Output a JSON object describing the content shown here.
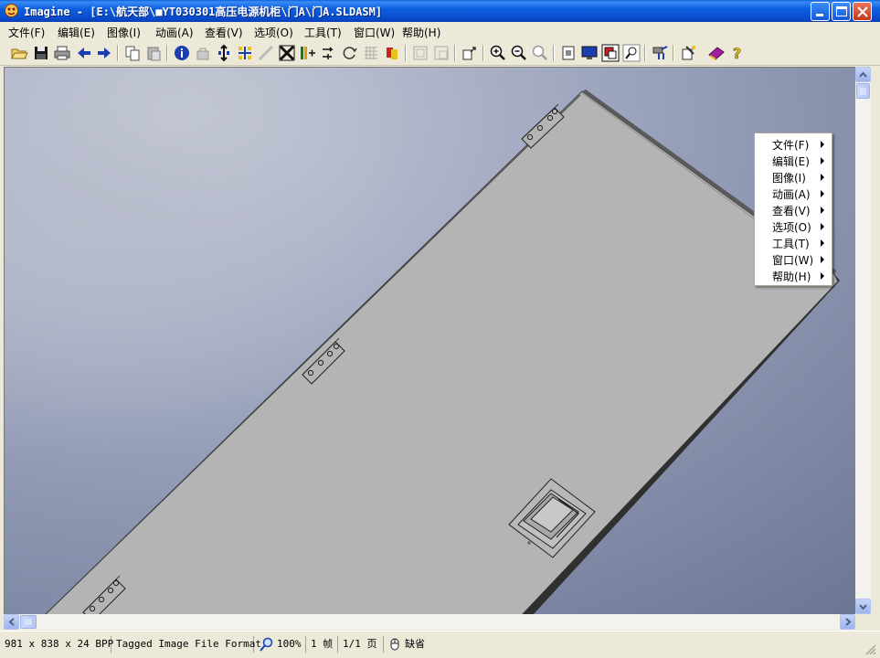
{
  "window": {
    "title": "Imagine - [E:\\航天部\\■YT030301高压电源机柜\\门A\\门A.SLDASM]"
  },
  "menubar": {
    "items": [
      {
        "label": "文件(F)"
      },
      {
        "label": "编辑(E)"
      },
      {
        "label": "图像(I)"
      },
      {
        "label": "动画(A)"
      },
      {
        "label": "查看(V)"
      },
      {
        "label": "选项(O)"
      },
      {
        "label": "工具(T)"
      },
      {
        "label": "窗口(W)"
      },
      {
        "label": "帮助(H)"
      }
    ]
  },
  "toolbar": {
    "icons": [
      "open-icon",
      "save-icon",
      "print-icon",
      "prev-icon",
      "next-icon",
      "copy-icon",
      "paste-icon",
      "info-icon",
      "resize-icon",
      "crop-icon",
      "rotate-icon",
      "flip-icon",
      "adjust-icon",
      "transform-icon",
      "refresh-icon",
      "grid-icon",
      "color-icon",
      "frame-icon",
      "frame2-icon",
      "fit-icon",
      "zoom-in-icon",
      "zoom-out-icon",
      "zoom-reset-icon",
      "fullscreen-icon",
      "monitor-icon",
      "slideshow-icon",
      "zoom-select-icon",
      "tools-icon",
      "plugin-icon",
      "book-icon",
      "help-icon"
    ]
  },
  "context_menu": {
    "items": [
      {
        "label": "文件(F)"
      },
      {
        "label": "编辑(E)"
      },
      {
        "label": "图像(I)"
      },
      {
        "label": "动画(A)"
      },
      {
        "label": "查看(V)"
      },
      {
        "label": "选项(O)"
      },
      {
        "label": "工具(T)"
      },
      {
        "label": "窗口(W)"
      },
      {
        "label": "帮助(H)"
      }
    ]
  },
  "statusbar": {
    "dimensions": "981 x 838 x 24 BPP",
    "format": "Tagged Image File Format",
    "zoom": "100%",
    "frames": "1 帧",
    "page": "1/1 页",
    "mode": "缺省"
  },
  "colors": {
    "title_bar": "#0e5fe0",
    "canvas_bg": "#8e98b4",
    "panel": "#b4b4b4"
  }
}
